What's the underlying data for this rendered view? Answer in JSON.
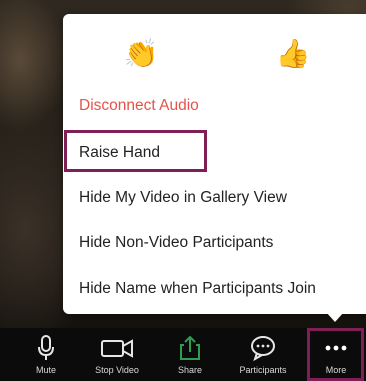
{
  "reactions": [
    {
      "name": "clap",
      "glyph": "👏"
    },
    {
      "name": "thumbs-up",
      "glyph": "👍"
    }
  ],
  "menu": {
    "disconnect_audio": "Disconnect Audio",
    "raise_hand": "Raise Hand",
    "hide_my_video": "Hide My Video in Gallery View",
    "hide_non_video": "Hide Non-Video Participants",
    "hide_name_on_join": "Hide Name when Participants Join"
  },
  "toolbar": {
    "mute": "Mute",
    "stop_video": "Stop Video",
    "share": "Share",
    "participants": "Participants",
    "more": "More"
  },
  "colors": {
    "danger": "#e5534b",
    "highlight": "#7f1f56",
    "share_green": "#2e9e4f",
    "toolbar_bg": "#0b0b0b"
  }
}
